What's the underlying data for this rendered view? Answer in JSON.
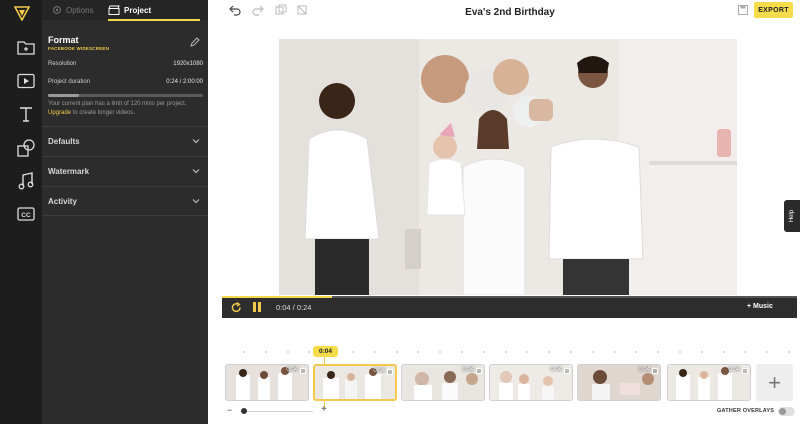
{
  "side_panel": {
    "tabs": {
      "options": "Options",
      "project": "Project"
    },
    "format": {
      "title": "Format",
      "subtitle": "FACEBOOK WIDESCREEN"
    },
    "resolution": {
      "label": "Resolution",
      "value": "1920x1080"
    },
    "duration": {
      "label": "Project duration",
      "value": "0:24 / 2:00:00",
      "used_fraction": 0.2
    },
    "plan_text_1": "Your current plan has a limit of 120 mins per project. ",
    "plan_link": "Upgrade",
    "plan_text_2": " to create longer videos.",
    "sections": [
      "Defaults",
      "Watermark",
      "Activity"
    ]
  },
  "rail_icons": [
    "folder-icon",
    "video-icon",
    "text-icon",
    "shapes-icon",
    "music-icon",
    "subtitles-icon"
  ],
  "header": {
    "title": "Eva's 2nd Birthday",
    "export_label": "EXPORT"
  },
  "player": {
    "time": "0:04 / 0:24",
    "music_label": "+ Music"
  },
  "help_label": "Help",
  "timeline": {
    "playhead": "0:04",
    "clips": [
      {
        "duration": "0:04"
      },
      {
        "duration": "0:04"
      },
      {
        "duration": "0:04"
      },
      {
        "duration": "0:04"
      },
      {
        "duration": "0:04"
      },
      {
        "duration": "0:04"
      }
    ],
    "gather_overlays_label": "GATHER OVERLAYS"
  },
  "colors": {
    "accent": "#f5dc4a",
    "panel": "#2c2c2c",
    "rail": "#1d1d1d"
  }
}
